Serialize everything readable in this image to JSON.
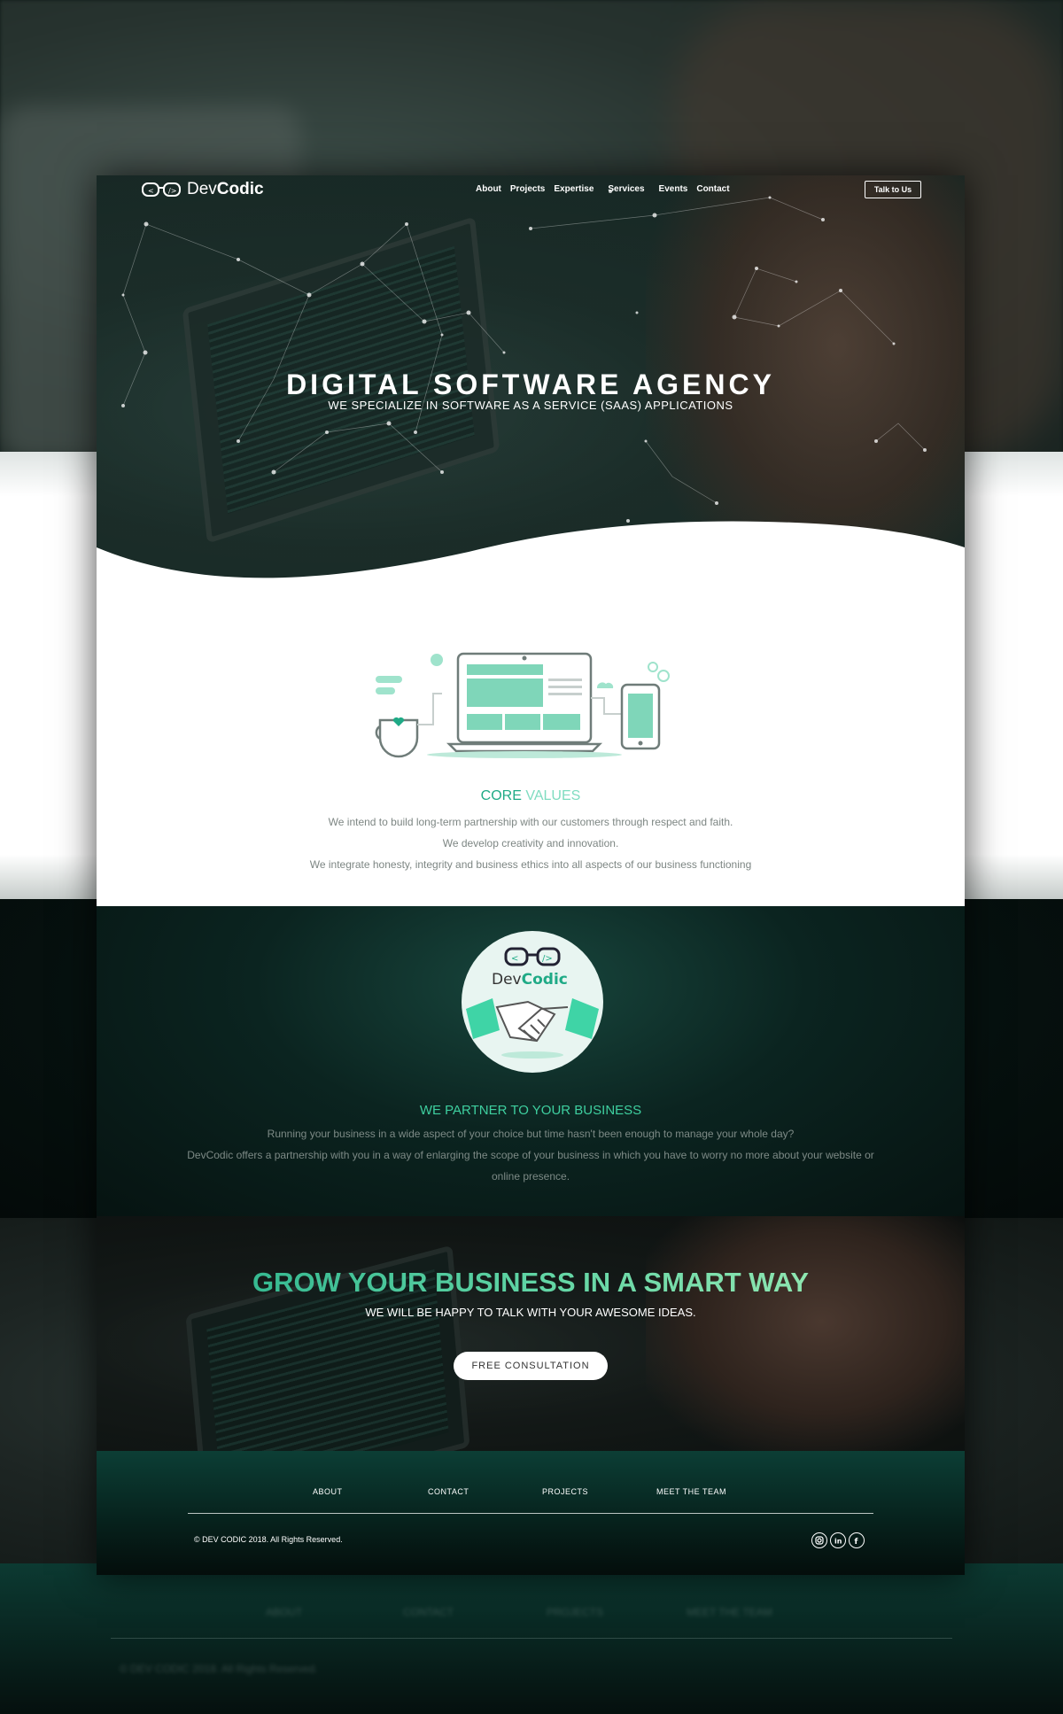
{
  "nav": {
    "logo_glyph": "ↄ|ↄ",
    "brand_light": "Dev",
    "brand_bold": "Codic",
    "items": [
      "About",
      "Projects",
      "Expertise",
      "Services",
      "Events",
      "Contact"
    ],
    "cta": "Talk to Us"
  },
  "hero": {
    "title": "DIGITAL SOFTWARE AGENCY",
    "subtitle": "WE SPECIALIZE IN SOFTWARE AS A SERVICE (SAAS) APPLICATIONS"
  },
  "core_values": {
    "title_a": "CORE",
    "title_b": "VALUES",
    "lines": [
      "We intend to build long-term partnership with our customers through respect and faith.",
      "We develop creativity and innovation.",
      "We integrate honesty, integrity and business ethics into all aspects of our business functioning"
    ]
  },
  "partner": {
    "logo_text_a": "Dev",
    "logo_text_b": "Codic",
    "title": "WE PARTNER TO YOUR BUSINESS",
    "lines": [
      "Running your business in a wide aspect of your choice but time hasn't been enough to manage your whole day?",
      "DevCodic offers a partnership with you in a way of enlarging the scope of your business in which you have to worry no more about your website or",
      "online presence."
    ]
  },
  "grow": {
    "title": "GROW YOUR BUSINESS IN A SMART WAY",
    "subtitle": "WE WILL BE HAPPY TO TALK WITH YOUR AWESOME IDEAS.",
    "button": "FREE CONSULTATION"
  },
  "footer": {
    "links": [
      "ABOUT",
      "CONTACT",
      "PROJECTS",
      "MEET THE TEAM"
    ],
    "copyright": "© DEV CODIC 2018. All Rights Reserved.",
    "social": [
      "instagram-icon",
      "linkedin-icon",
      "facebook-icon"
    ]
  },
  "colors": {
    "accent": "#1faa86",
    "accent_light": "#7fdcc0",
    "dark": "#0b2420"
  }
}
